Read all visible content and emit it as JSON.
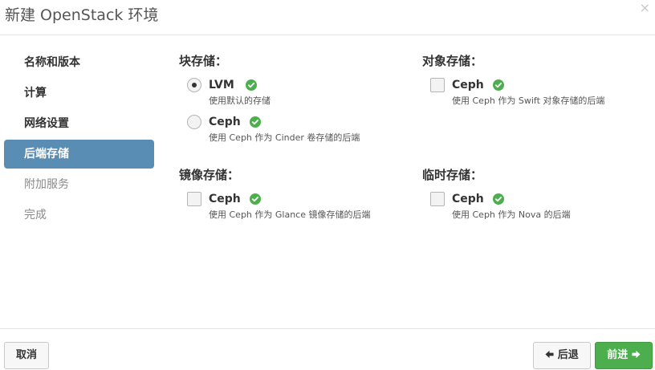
{
  "dialog": {
    "title": "新建 OpenStack 环境",
    "close": "×"
  },
  "nav": {
    "items": [
      {
        "label": "名称和版本"
      },
      {
        "label": "计算"
      },
      {
        "label": "网络设置"
      },
      {
        "label": "后端存储"
      },
      {
        "label": "附加服务"
      },
      {
        "label": "完成"
      }
    ]
  },
  "storage": {
    "block": {
      "title": "块存储：",
      "options": [
        {
          "name": "LVM",
          "desc": "使用默认的存储",
          "checked": true
        },
        {
          "name": "Ceph",
          "desc": "使用 Ceph 作为 Cinder 卷存储的后端",
          "checked": false
        }
      ]
    },
    "object": {
      "title": "对象存储：",
      "options": [
        {
          "name": "Ceph",
          "desc": "使用 Ceph 作为 Swift 对象存储的后端",
          "checked": false
        }
      ]
    },
    "image": {
      "title": "镜像存储：",
      "options": [
        {
          "name": "Ceph",
          "desc": "使用 Ceph 作为 Glance 镜像存储的后端",
          "checked": false
        }
      ]
    },
    "ephemeral": {
      "title": "临时存储：",
      "options": [
        {
          "name": "Ceph",
          "desc": "使用 Ceph 作为 Nova 的后端",
          "checked": false
        }
      ]
    }
  },
  "footer": {
    "cancel": "取消",
    "back": "后退",
    "next": "前进"
  },
  "colors": {
    "active_nav": "#5a8db3",
    "primary_button": "#4cae4c",
    "check_icon": "#4cae4c"
  },
  "icons": {
    "check": "check-circle-icon",
    "back": "arrow-left-icon",
    "next": "arrow-right-icon",
    "close": "close-icon"
  }
}
